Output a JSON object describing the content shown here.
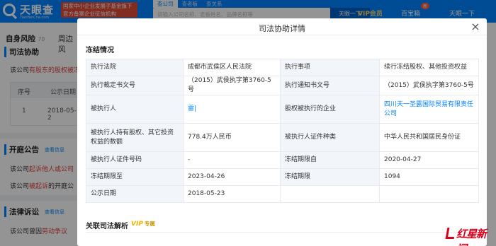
{
  "header": {
    "logo_text": "天眼查",
    "logo_sub": "TianYanCha.com",
    "slogan": "国家中小企业发展子基金旗下 官方备案企业征信机构",
    "search_tabs": [
      "查公司",
      "查老板",
      "查关系"
    ],
    "search_placeholder": "请输入公司名称、老板姓名、品牌名称等",
    "search_button": "天眼一下",
    "vip": "VIP会员",
    "nav": [
      "百宝箱",
      "天眼一下"
    ],
    "new_badge": "新"
  },
  "subnav": {
    "active": "自身风险",
    "active_count": "70",
    "other": "周边风"
  },
  "background": {
    "section1_title": "司法协助",
    "section1_line_prefix": "该公司",
    "section1_line_red": "有股东的股权被冻",
    "table_head": [
      "序号",
      "公示日期"
    ],
    "table_row": [
      "1",
      "2018-05-2"
    ],
    "section2_title": "开庭公告",
    "section2_tag": "查看信息",
    "section2_line1_prefix": "该公司",
    "section2_line1_red": "起诉他人或公司",
    "section2_line2_prefix": "该公司",
    "section2_line2_red": "被起诉",
    "section2_line2_suffix": "的开庭公",
    "section3_title": "法律诉讼",
    "section3_tag": "查看信息",
    "section3_line_prefix": "该公司曾因",
    "section3_line_red": "劳动争议"
  },
  "modal": {
    "title": "司法协助详情",
    "close": "×",
    "freeze_section": "冻结情况",
    "rows": [
      {
        "l1": "执行法院",
        "v1": "成都市武侯区人民法院",
        "l2": "执行事项",
        "v2": "续行冻结股权、其他投资权益"
      },
      {
        "l1": "执行裁定书文号",
        "v1": "（2015）武侯执字第3760-5号",
        "l2": "执行通知书文号",
        "v2": "（2015）武侯执字第3760-5号"
      },
      {
        "l1": "被执行人",
        "v1": "雷|",
        "l2": "股权被执行的企业",
        "v2": "四川天一圣露国际贸易有限责任公司"
      },
      {
        "l1": "被执行人持有股权、其它投资权益的数额",
        "v1": "778.4万人民币",
        "l2": "被执行人证件种类",
        "v2": "中华人民共和国居民身份证"
      },
      {
        "l1": "被执行人证件号码",
        "v1": "-",
        "l2": "冻结期限自",
        "v2": "2020-04-27"
      },
      {
        "l1": "冻结期限至",
        "v1": "2023-04-26",
        "l2": "冻结期限",
        "v2": "1094"
      },
      {
        "l1": "公示日期",
        "v1": "2018-05-23",
        "l2": "",
        "v2": ""
      }
    ],
    "related_section": "关联司法解析",
    "vip_label": "VIP",
    "vip_suffix": "专属"
  },
  "watermark": {
    "text": "红星新闻"
  }
}
